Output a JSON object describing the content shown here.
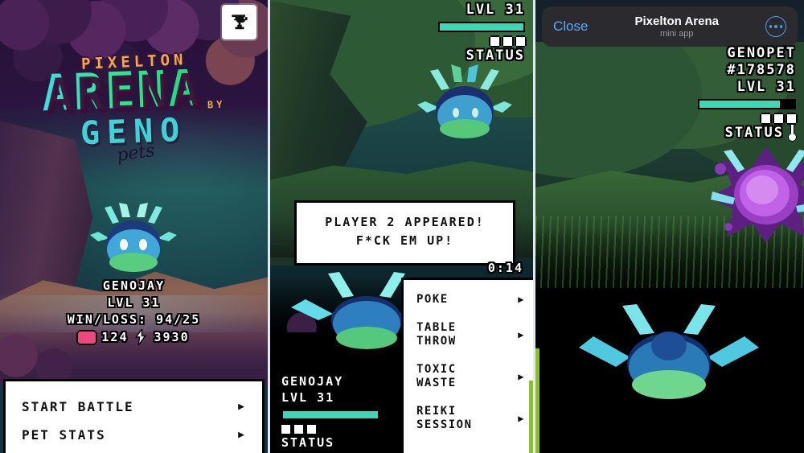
{
  "panel1": {
    "trophy_icon": "trophy-icon",
    "title": {
      "line1": "PIXELTON",
      "line2": "ARENA",
      "by": "BY",
      "brand": "GENO",
      "script": "pets"
    },
    "stats": {
      "name": "GENOJAY",
      "level": "LVL 31",
      "winloss": "WIN/LOSS:  94/25",
      "gem_icon": "gem-icon",
      "gem_value": "124",
      "bolt_icon": "lightning-bolt-icon",
      "bolt_value": "3930"
    },
    "menu": [
      {
        "label": "START BATTLE",
        "arrow": "▶"
      },
      {
        "label": "PET STATS",
        "arrow": "▶"
      }
    ]
  },
  "panel2": {
    "enemy_hud": {
      "level": "LVL 31",
      "health_pct": 100,
      "squares": 3,
      "status": "STATUS"
    },
    "dialog": {
      "line1": "PLAYER 2 APPEARED!",
      "line2": "F*CK EM UP!"
    },
    "timer": "0:14",
    "player_hud": {
      "name": "GENOJAY",
      "level": "LVL 31",
      "health_pct": 100,
      "squares": 3,
      "status": "STATUS"
    },
    "actions": [
      {
        "label": "POKE",
        "arrow": "▶"
      },
      {
        "label": "TABLE\nTHROW",
        "arrow": "▶"
      },
      {
        "label": "TOXIC\nWASTE",
        "arrow": "▶"
      },
      {
        "label": "REIKI\nSESSION",
        "arrow": "▶"
      }
    ]
  },
  "panel3": {
    "header": {
      "close": "Close",
      "title": "Pixelton Arena",
      "subtitle": "mini app",
      "menu_icon": "more-options-icon"
    },
    "hud": {
      "name": "GENOPET",
      "id": "#178578",
      "level": "LVL 31",
      "health_pct": 85,
      "squares": 3,
      "status": "STATUS",
      "status_icon": "thermometer-icon"
    }
  },
  "colors": {
    "accent_green": "#2ee68c",
    "accent_cyan": "#3fd3d8",
    "accent_orange": "#f0a851",
    "health_bar": "#3ed6b4",
    "gem_pink": "#f0487e",
    "telegram_blue": "#5aa9f8",
    "edge_lime": "#8fbf26"
  }
}
